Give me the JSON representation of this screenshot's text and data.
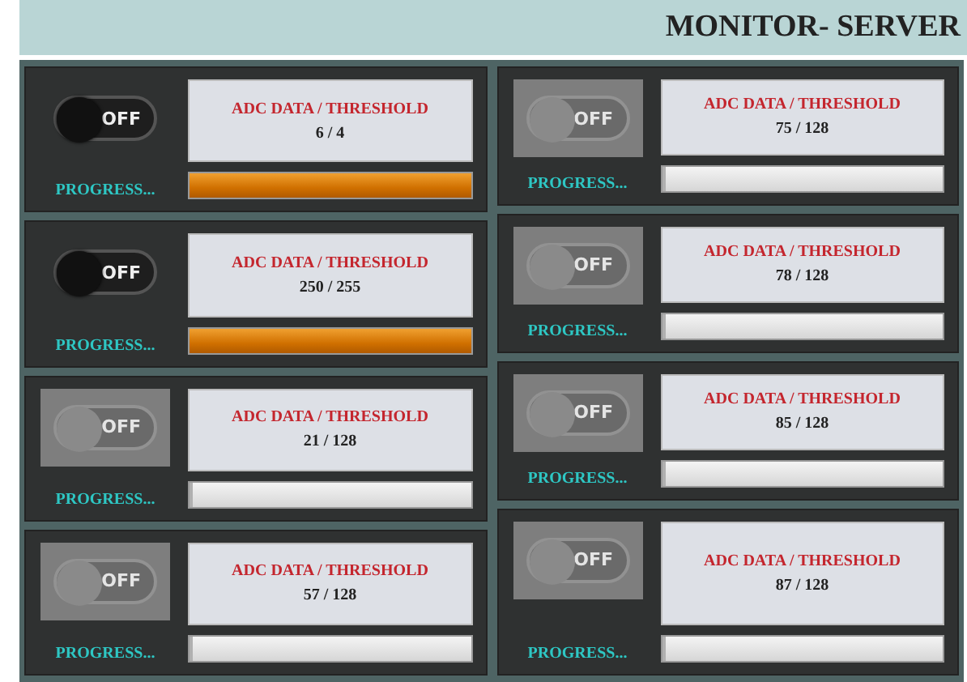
{
  "title": "MONITOR- SERVER",
  "columns": [
    {
      "panels": [
        {
          "switch": {
            "label": "OFF",
            "disabled": false
          },
          "data_label": "ADC DATA / THRESHOLD",
          "value": "6 / 4",
          "progress_label": "PROGRESS...",
          "level": 1
        },
        {
          "switch": {
            "label": "OFF",
            "disabled": false
          },
          "data_label": "ADC DATA / THRESHOLD",
          "value": "250 / 255",
          "progress_label": "PROGRESS...",
          "level": 1
        },
        {
          "switch": {
            "label": "OFF",
            "disabled": true
          },
          "data_label": "ADC DATA / THRESHOLD",
          "value": "21 / 128",
          "progress_label": "PROGRESS...",
          "level": 0
        },
        {
          "switch": {
            "label": "OFF",
            "disabled": true
          },
          "data_label": "ADC DATA / THRESHOLD",
          "value": "57 / 128",
          "progress_label": "PROGRESS...",
          "level": 0
        }
      ]
    },
    {
      "panels": [
        {
          "switch": {
            "label": "OFF",
            "disabled": true
          },
          "data_label": "ADC DATA / THRESHOLD",
          "value": "75 / 128",
          "progress_label": "PROGRESS...",
          "level": 0
        },
        {
          "switch": {
            "label": "OFF",
            "disabled": true
          },
          "data_label": "ADC DATA / THRESHOLD",
          "value": "78 / 128",
          "progress_label": "PROGRESS...",
          "level": 0
        },
        {
          "switch": {
            "label": "OFF",
            "disabled": true
          },
          "data_label": "ADC DATA / THRESHOLD",
          "value": "85 / 128",
          "progress_label": "PROGRESS...",
          "level": 0
        },
        {
          "switch": {
            "label": "OFF",
            "disabled": true
          },
          "data_label": "ADC DATA / THRESHOLD",
          "value": "87 / 128",
          "progress_label": "PROGRESS...",
          "level": 0
        }
      ]
    }
  ]
}
